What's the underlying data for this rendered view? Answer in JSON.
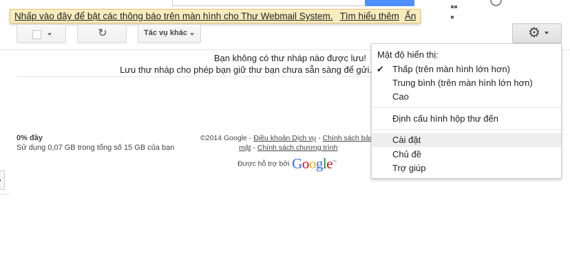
{
  "notification": {
    "message": "Nhấp vào đây để bật các thông báo trên màn hình cho Thư Webmail System.",
    "learn_more": "Tìm hiểu thêm",
    "hide": "Ẩn"
  },
  "toolbar": {
    "refresh_icon": "refresh-icon",
    "more_actions": "Tác vụ khác",
    "settings_icon": "gear-icon"
  },
  "empty_state": {
    "line1": "Bạn không có thư nháp nào được lưu!",
    "line2": "Lưu thư nháp cho phép bạn giữ thư bạn chưa sẵn sàng để gửi."
  },
  "storage": {
    "percent": "0% đầy",
    "usage": "Sử dụng 0,07 GB trong tổng số 15 GB của bạn"
  },
  "footer": {
    "copyright": "©2014 Google -",
    "terms": "Điều khoản Dịch vụ",
    "sep": "-",
    "privacy_part1": "Chính sách bảo",
    "privacy_part2": "mật",
    "program_policy": "Chính sách chương trình",
    "powered_by": "Được hỗ trợ bởi",
    "google_logo": "Google"
  },
  "settings_menu": {
    "density_header": "Mật độ hiển thị:",
    "density_low": "Thấp (trên màn hình lớn hơn)",
    "density_medium": "Trung bình (trên màn hình lớn hơn)",
    "density_high": "Cao",
    "configure_inbox": "Định cấu hình hộp thư đến",
    "settings": "Cài đặt",
    "themes": "Chủ đề",
    "help": "Trợ giúp",
    "checked_item": "density_low"
  },
  "colors": {
    "notification_bg": "#f9edbe",
    "notification_border": "#f0c36d",
    "search_button": "#4d90fe",
    "menu_hover": "#eeeeee"
  }
}
